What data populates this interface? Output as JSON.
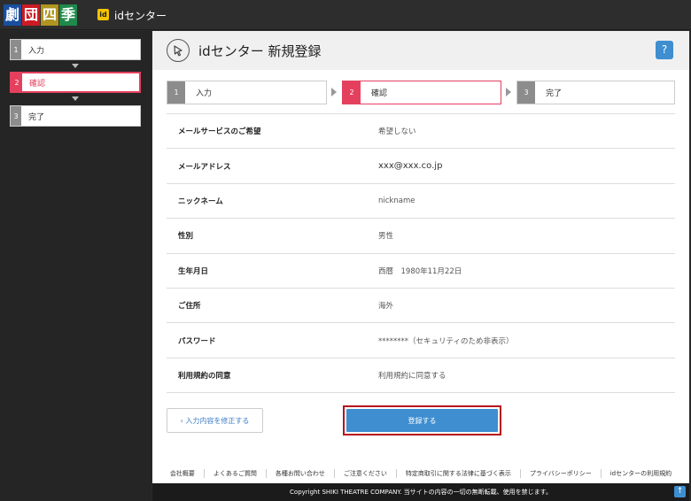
{
  "topbar": {
    "logo_chars": [
      "劇",
      "団",
      "四",
      "季"
    ],
    "id_badge": "id",
    "title": "idセンター"
  },
  "sidebar": {
    "steps": [
      {
        "num": "1",
        "label": "入力"
      },
      {
        "num": "2",
        "label": "確認",
        "active": true
      },
      {
        "num": "3",
        "label": "完了"
      }
    ]
  },
  "main": {
    "icon": "hand-pointer-icon",
    "title": "idセンター 新規登録",
    "help_label": "?",
    "progress": [
      {
        "num": "1",
        "label": "入力"
      },
      {
        "num": "2",
        "label": "確認",
        "active": true
      },
      {
        "num": "3",
        "label": "完了"
      }
    ],
    "rows": [
      {
        "key": "メールサービスのご希望",
        "value": "希望しない"
      },
      {
        "key": "メールアドレス",
        "value": "xxx@xxx.co.jp"
      },
      {
        "key": "ニックネーム",
        "value": "nickname"
      },
      {
        "key": "性別",
        "value": "男性"
      },
      {
        "key": "生年月日",
        "value": "西暦　1980年11月22日"
      },
      {
        "key": "ご住所",
        "value": "海外"
      },
      {
        "key": "パスワード",
        "value": "********（セキュリティのため非表示）"
      },
      {
        "key": "利用規約の同意",
        "value": "利用規約に同意する"
      }
    ],
    "back_label": "‹ 入力内容を修正する",
    "submit_label": "登録する"
  },
  "footer": {
    "links": [
      "会社概要",
      "よくあるご質問",
      "各種お問い合わせ",
      "ご注意ください",
      "特定商取引に関する法律に基づく表示",
      "プライバシーポリシー",
      "idセンターの利用規約"
    ],
    "copyright": "Copyright SHIKI THEATRE COMPANY. 当サイトの内容の一切の無断転載、使用を禁じます。",
    "pagetop_label": "↑"
  },
  "colors": {
    "accent_pink": "#e4405e",
    "button_blue": "#3e8ed0",
    "highlight_red": "#b5121b"
  }
}
